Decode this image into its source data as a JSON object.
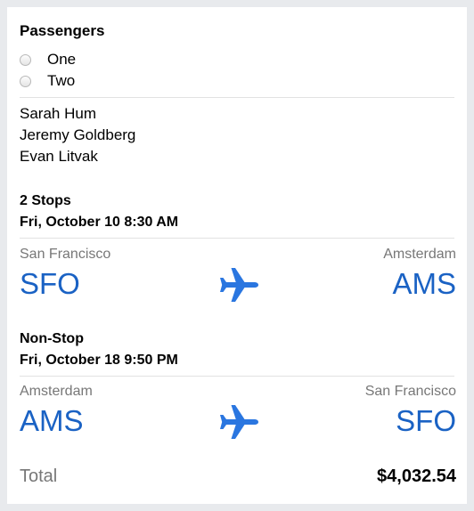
{
  "passengers": {
    "title": "Passengers",
    "options": [
      {
        "label": "One",
        "selected": false
      },
      {
        "label": "Two",
        "selected": false
      }
    ],
    "names": [
      "Sarah Hum",
      "Jeremy Goldberg",
      "Evan Litvak"
    ]
  },
  "flights": [
    {
      "stops": "2 Stops",
      "datetime": "Fri, October 10 8:30 AM",
      "origin_city": "San Francisco",
      "origin_code": "SFO",
      "dest_city": "Amsterdam",
      "dest_code": "AMS",
      "icon": "airplane-icon"
    },
    {
      "stops": "Non-Stop",
      "datetime": "Fri, October 18 9:50 PM",
      "origin_city": "Amsterdam",
      "origin_code": "AMS",
      "dest_city": "San Francisco",
      "dest_code": "SFO",
      "icon": "airplane-icon"
    }
  ],
  "total": {
    "label": "Total",
    "amount": "$4,032.54"
  },
  "colors": {
    "accent": "#1a62c4",
    "plane": "#2a76e0",
    "muted_text": "#777777",
    "background": "#e8eaed"
  }
}
